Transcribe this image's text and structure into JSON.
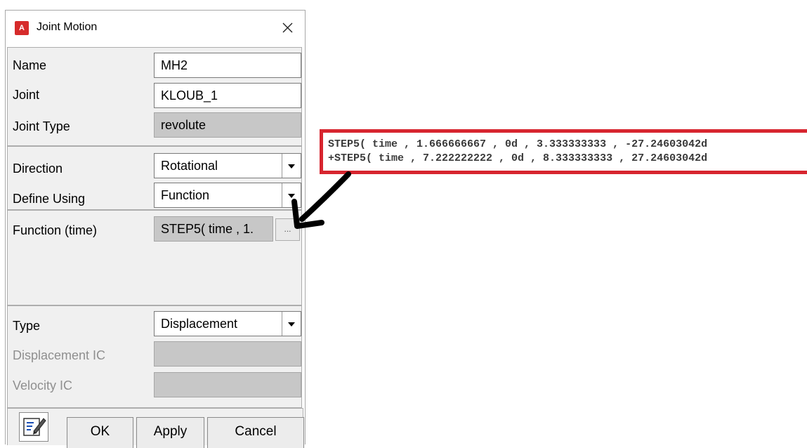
{
  "dialog": {
    "icon_letter": "A",
    "title": "Joint Motion",
    "close_glyph": "✕"
  },
  "fields": {
    "name": {
      "label": "Name",
      "value": "MH2"
    },
    "joint": {
      "label": "Joint",
      "value": "KLOUB_1"
    },
    "joint_type": {
      "label": "Joint Type",
      "value": "revolute"
    },
    "direction": {
      "label": "Direction",
      "value": "Rotational"
    },
    "define_using": {
      "label": "Define Using",
      "value": "Function"
    },
    "function": {
      "label": "Function (time)",
      "value": "STEP5( time , 1.",
      "button": "..."
    },
    "type": {
      "label": "Type",
      "value": "Displacement"
    },
    "displacement_ic": {
      "label": "Displacement IC",
      "value": ""
    },
    "velocity_ic": {
      "label": "Velocity IC",
      "value": ""
    }
  },
  "buttons": {
    "ok": "OK",
    "apply": "Apply",
    "cancel": "Cancel"
  },
  "function_preview": {
    "line1": "STEP5( time , 1.666666667 , 0d , 3.333333333 , -27.24603042d",
    "line2": "+STEP5( time , 7.222222222 , 0d , 8.333333333 , 27.24603042d"
  },
  "colors": {
    "highlight_border": "#d7252f",
    "app_icon": "#d62b2b"
  }
}
